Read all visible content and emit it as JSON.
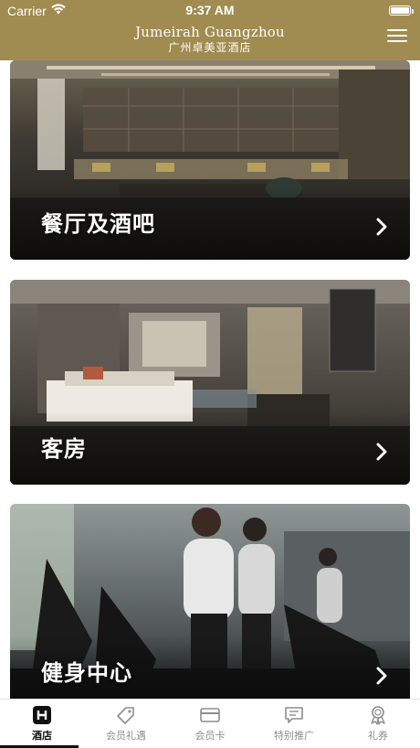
{
  "status_bar": {
    "carrier": "Carrier",
    "time": "9:37 AM"
  },
  "header": {
    "title_en": "Jumeirah Guangzhou",
    "title_cn": "广州卓美亚酒店",
    "menu_icon": "hamburger-menu-icon"
  },
  "cards": [
    {
      "label": "餐厅及酒吧",
      "icon": "chevron-right-icon"
    },
    {
      "label": "客房",
      "icon": "chevron-right-icon"
    },
    {
      "label": "健身中心",
      "icon": "chevron-right-icon"
    }
  ],
  "tabbar": {
    "tabs": [
      {
        "label": "酒店",
        "icon": "hotel-h-icon",
        "active": true
      },
      {
        "label": "会员礼遇",
        "icon": "tag-icon",
        "active": false
      },
      {
        "label": "会员卡",
        "icon": "card-icon",
        "active": false
      },
      {
        "label": "特别推广",
        "icon": "message-icon",
        "active": false
      },
      {
        "label": "礼券",
        "icon": "ribbon-badge-icon",
        "active": false
      }
    ]
  },
  "colors": {
    "header_bg": "#a08b50",
    "tab_active": "#111111",
    "tab_inactive": "#8e8e8e"
  }
}
